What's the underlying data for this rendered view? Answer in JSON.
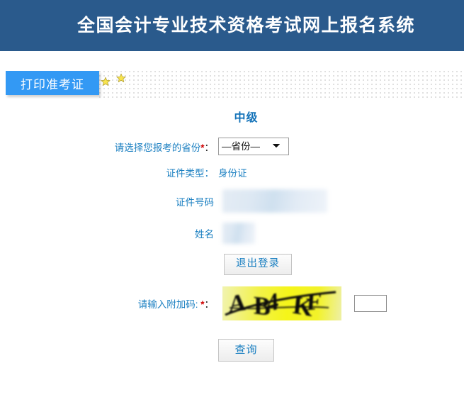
{
  "header": {
    "title": "全国会计专业技术资格考试网上报名系统",
    "background_color": "#2a5a8c",
    "text_color": "#ffffff"
  },
  "tabs": {
    "active": "打印准考证",
    "items": [
      {
        "label": "打印准考证",
        "active": true,
        "color": "#3399f4"
      }
    ],
    "decorations": [
      {
        "icon": "star-icon",
        "color": "#f7e04b"
      },
      {
        "icon": "star-icon",
        "color": "#f7e04b"
      }
    ]
  },
  "form": {
    "level_title": "中级",
    "level_title_color": "#1171b8",
    "province": {
      "label": "请选择您报考的省份",
      "required_marker": "*",
      "colon": "：",
      "selected": "—省份—",
      "options": [
        "—省份—"
      ]
    },
    "id_type": {
      "label": "证件类型：",
      "value": "身份证"
    },
    "id_number": {
      "label": "证件号码",
      "value": "",
      "redacted": true
    },
    "name": {
      "label": "姓名",
      "value": "",
      "redacted": true
    },
    "logout": {
      "label": "退出登录"
    },
    "captcha": {
      "label": "请输入附加码:",
      "required_marker": "*",
      "colon": "：",
      "image_text": "AB4KF",
      "image_background_color": "#f2f219",
      "input_value": "",
      "input_placeholder": ""
    },
    "submit": {
      "label": "查询"
    }
  }
}
